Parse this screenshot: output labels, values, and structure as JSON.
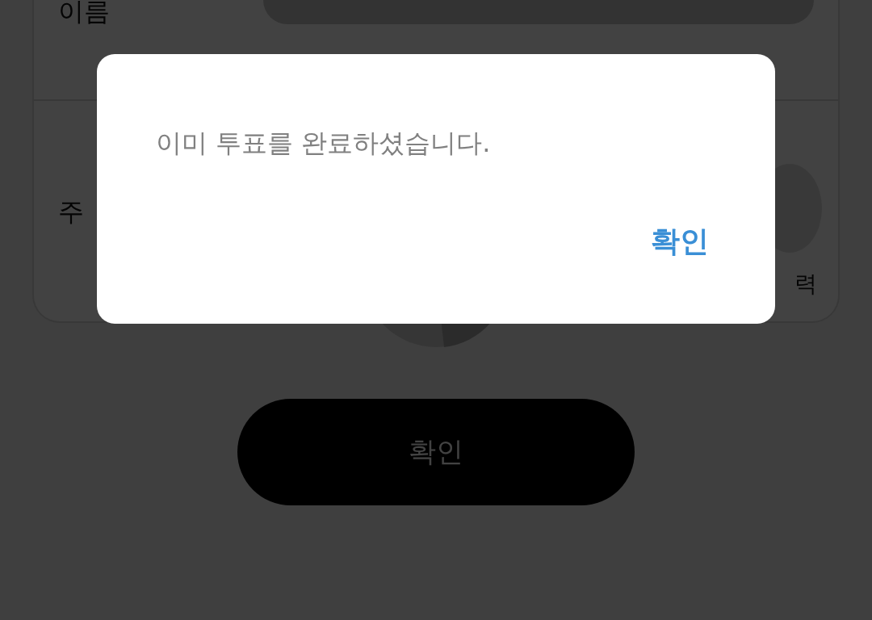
{
  "form": {
    "rows": [
      {
        "label": "이름"
      },
      {
        "label": "주",
        "side_text": "력"
      }
    ]
  },
  "submit_button": {
    "label": "확인"
  },
  "dialog": {
    "message": "이미 투표를 완료하셨습니다.",
    "button": "확인"
  }
}
